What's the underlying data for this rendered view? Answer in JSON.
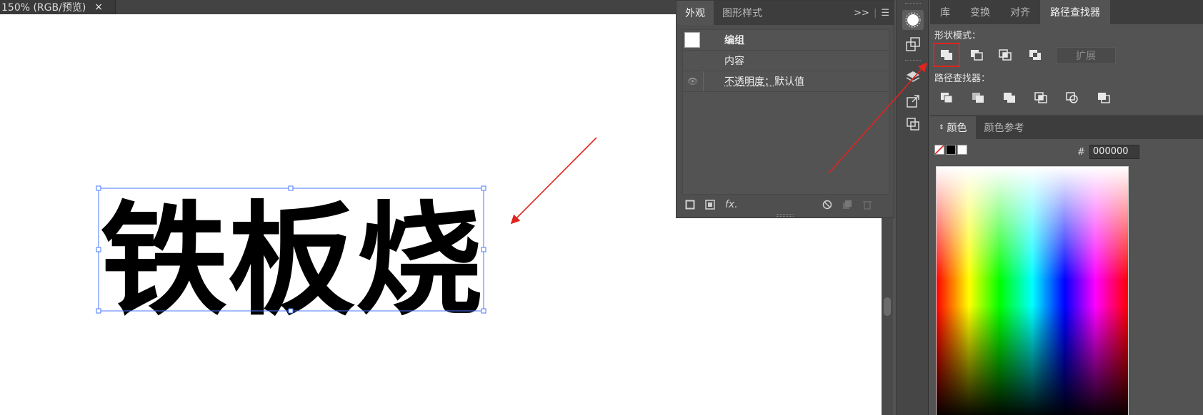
{
  "document": {
    "tab_title": "150% (RGB/预览)",
    "close_glyph": "×"
  },
  "artwork": {
    "text": "铁板烧"
  },
  "appearance": {
    "tabs": [
      {
        "label": "外观",
        "active": true
      },
      {
        "label": "图形样式",
        "active": false
      }
    ],
    "collapse_glyph": ">>",
    "menu_glyph": "☰",
    "rows": {
      "group_label": "编组",
      "content_label": "内容",
      "opacity_label": "不透明度：",
      "opacity_value": "默认值"
    },
    "footer_fx": "fx."
  },
  "pathfinder": {
    "tabs": [
      {
        "label": "库",
        "active": false
      },
      {
        "label": "变换",
        "active": false
      },
      {
        "label": "对齐",
        "active": false
      },
      {
        "label": "路径查找器",
        "active": true
      }
    ],
    "shape_modes_label": "形状模式：",
    "expand_label": "扩展",
    "pathfinders_label": "路径查找器："
  },
  "color": {
    "tabs": [
      {
        "label": "颜色",
        "active": true
      },
      {
        "label": "颜色参考",
        "active": false
      }
    ],
    "hash": "#",
    "hex_value": "000000",
    "accent_annotation": "#e0241e"
  }
}
